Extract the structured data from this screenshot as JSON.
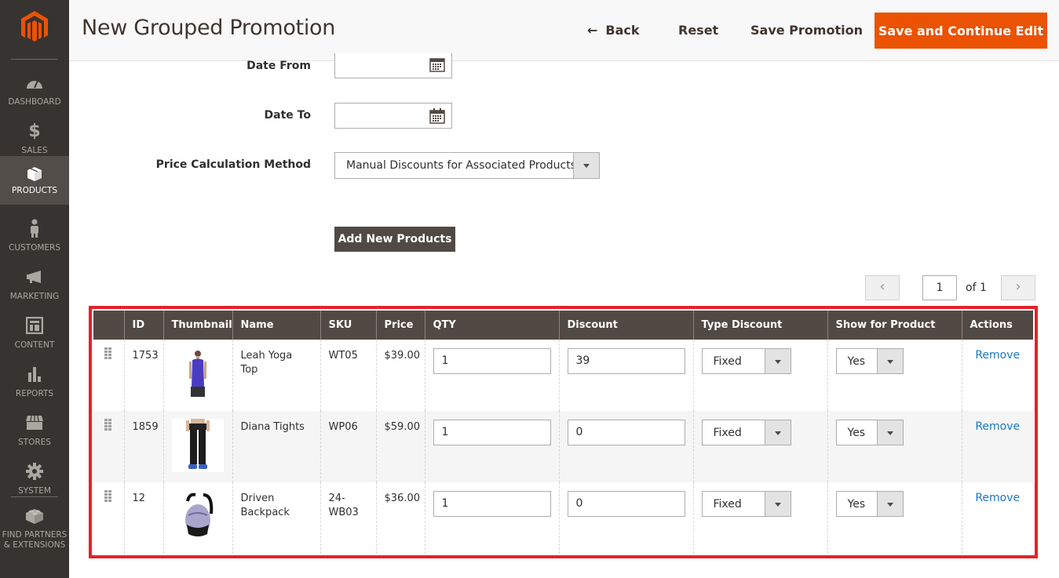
{
  "sidebar": {
    "logo": "magento-logo",
    "items": [
      {
        "label": "DASHBOARD",
        "icon": "dashboard-gauge-icon",
        "active": false
      },
      {
        "label": "SALES",
        "icon": "dollar-icon",
        "active": false
      },
      {
        "label": "PRODUCTS",
        "icon": "box-icon",
        "active": true
      },
      {
        "label": "CUSTOMERS",
        "icon": "person-icon",
        "active": false
      },
      {
        "label": "MARKETING",
        "icon": "megaphone-icon",
        "active": false
      },
      {
        "label": "CONTENT",
        "icon": "layout-icon",
        "active": false
      },
      {
        "label": "REPORTS",
        "icon": "bar-chart-icon",
        "active": false
      },
      {
        "label": "STORES",
        "icon": "storefront-icon",
        "active": false
      },
      {
        "label": "SYSTEM",
        "icon": "gear-icon",
        "active": false
      },
      {
        "label": "FIND PARTNERS & EXTENSIONS",
        "label_line1": "FIND PARTNERS",
        "label_line2": "& EXTENSIONS",
        "icon": "lego-brick-icon",
        "active": false
      }
    ]
  },
  "header": {
    "title": "New Grouped Promotion",
    "back_label": "Back",
    "reset_label": "Reset",
    "save_label": "Save Promotion",
    "save_continue_label": "Save and Continue Edit",
    "accent_color": "#eb5202"
  },
  "form": {
    "date_from": {
      "label": "Date From",
      "value": ""
    },
    "date_to": {
      "label": "Date To",
      "value": ""
    },
    "price_method": {
      "label": "Price Calculation Method",
      "value": "Manual Discounts for Associated Products"
    },
    "add_button_label": "Add New Products"
  },
  "pager": {
    "prev": "‹",
    "next": "›",
    "current_page": "1",
    "of_label": "of 1"
  },
  "grid": {
    "highlight_color": "#e3232a",
    "columns": [
      "",
      "ID",
      "Thumbnail",
      "Name",
      "SKU",
      "Price",
      "QTY",
      "Discount",
      "Type Discount",
      "Show for Product",
      "Actions"
    ],
    "rows": [
      {
        "id": "1753",
        "thumbnail": "yoga-top-image",
        "name": "Leah Yoga Top",
        "sku": "WT05",
        "price": "$39.00",
        "qty": "1",
        "discount": "39",
        "type_discount": "Fixed",
        "show_for_product": "Yes",
        "action": "Remove"
      },
      {
        "id": "1859",
        "thumbnail": "tights-image",
        "name": "Diana Tights",
        "sku": "WP06",
        "price": "$59.00",
        "qty": "1",
        "discount": "0",
        "type_discount": "Fixed",
        "show_for_product": "Yes",
        "action": "Remove"
      },
      {
        "id": "12",
        "thumbnail": "backpack-image",
        "name": "Driven Backpack",
        "sku": "24-WB03",
        "price": "$36.00",
        "qty": "1",
        "discount": "0",
        "type_discount": "Fixed",
        "show_for_product": "Yes",
        "action": "Remove"
      }
    ]
  }
}
